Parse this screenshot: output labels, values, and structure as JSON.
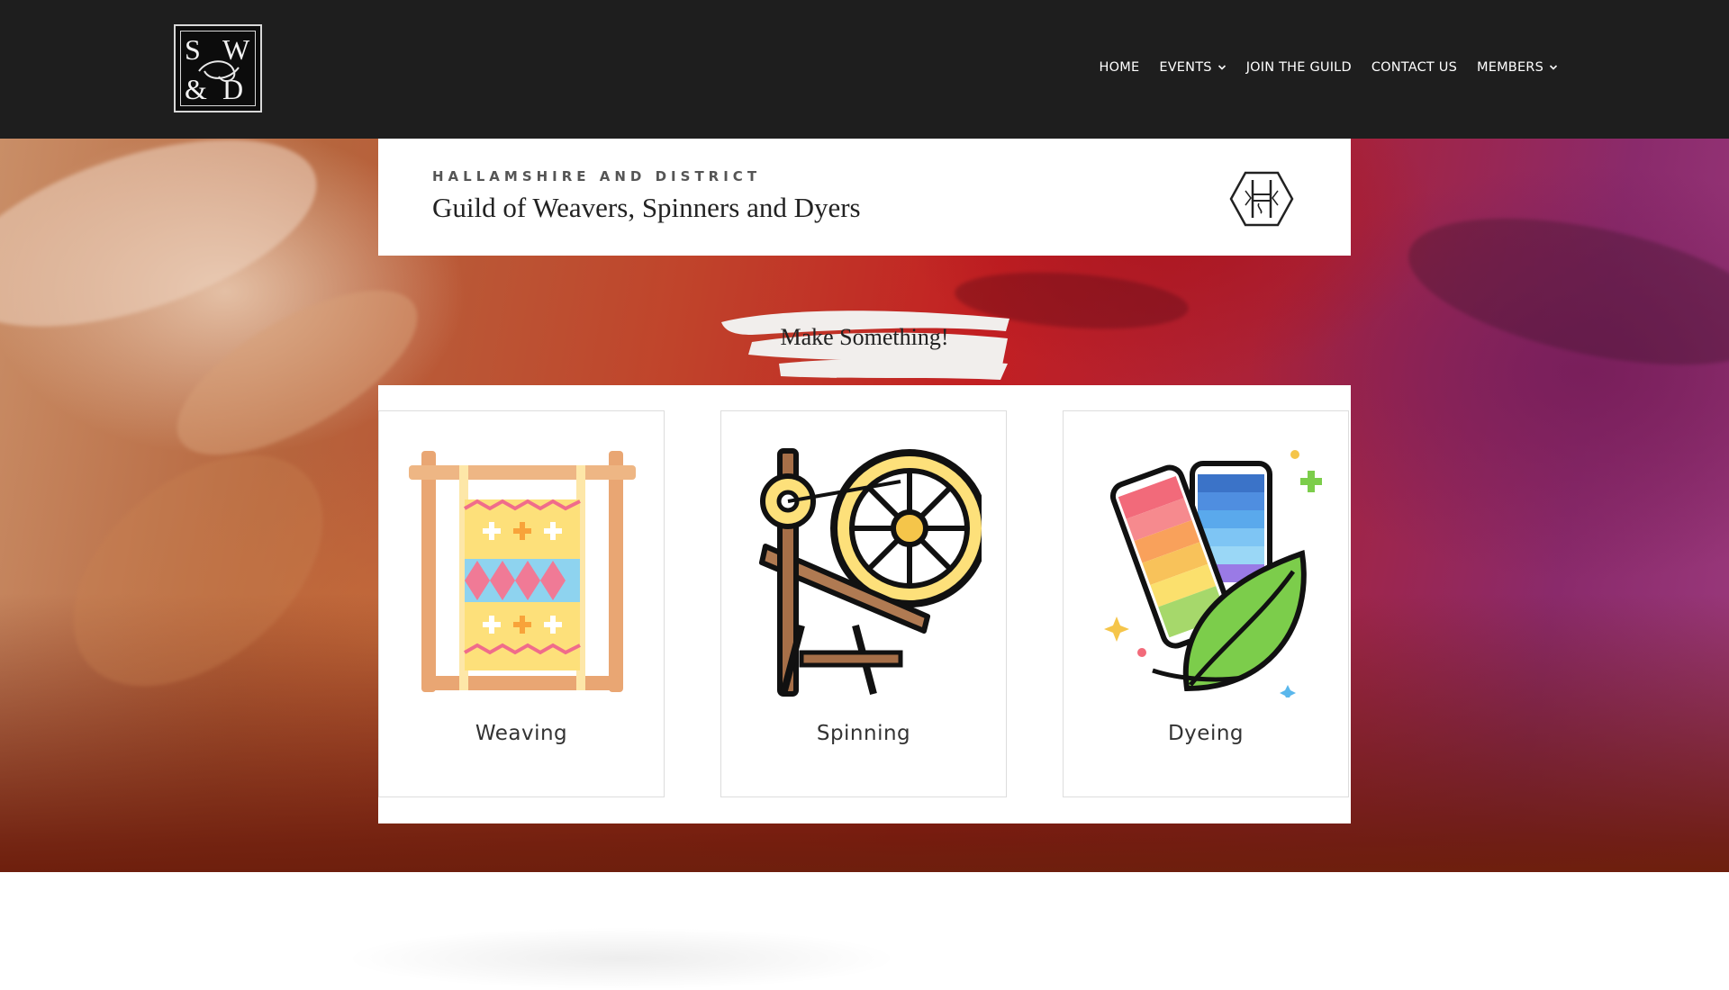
{
  "header": {
    "logo": {
      "letters": [
        "S",
        "W",
        "&",
        "D"
      ],
      "icon": "swd-logo"
    },
    "nav": [
      {
        "label": "HOME",
        "has_dropdown": false
      },
      {
        "label": "EVENTS",
        "has_dropdown": true
      },
      {
        "label": "JOIN THE GUILD",
        "has_dropdown": false
      },
      {
        "label": "CONTACT US",
        "has_dropdown": false
      },
      {
        "label": "MEMBERS",
        "has_dropdown": true
      }
    ]
  },
  "title_card": {
    "subtitle": "HALLAMSHIRE AND DISTRICT",
    "title": "Guild of Weavers, Spinners and Dyers",
    "icon": "hexagon-guild-logo-icon"
  },
  "section": {
    "heading": "Make Something!"
  },
  "cards": [
    {
      "label": "Weaving",
      "icon": "loom-icon"
    },
    {
      "label": "Spinning",
      "icon": "spinning-wheel-icon"
    },
    {
      "label": "Dyeing",
      "icon": "yarn-spools-leaf-icon"
    }
  ],
  "colors": {
    "header_bg": "#1e1e1e",
    "hero_red": "#c21f22",
    "hero_purple": "#8a2a6b",
    "hero_bottom": "#6e1f0d"
  }
}
